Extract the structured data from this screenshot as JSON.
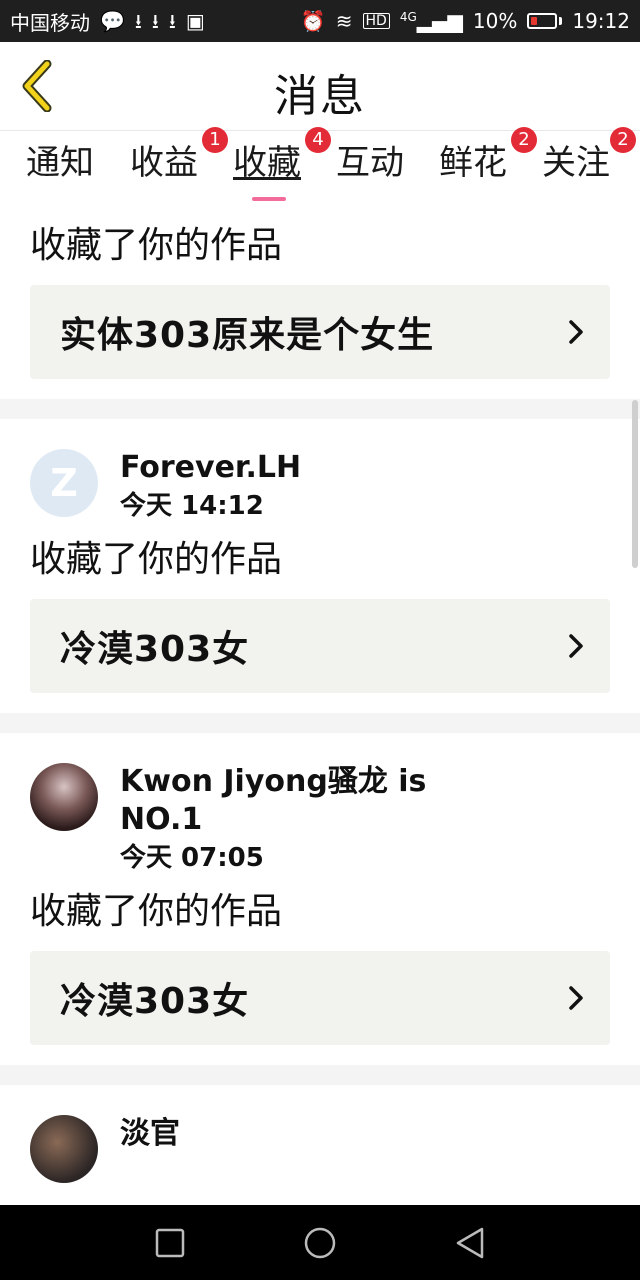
{
  "status_bar": {
    "carrier": "中国移动",
    "network": "4G",
    "battery": "10%",
    "time": "19:12",
    "icons": [
      "wechat-icon",
      "download-icon",
      "download-icon",
      "download-icon",
      "image-icon",
      "alarm-icon",
      "wifi-icon",
      "hd-icon",
      "signal-icon",
      "battery-icon"
    ]
  },
  "header": {
    "title": "消息",
    "back_icon": "chevron-left-icon"
  },
  "tabs": [
    {
      "label": "通知",
      "badge": ""
    },
    {
      "label": "收益",
      "badge": "1"
    },
    {
      "label": "收藏",
      "badge": "4",
      "active": true
    },
    {
      "label": "互动",
      "badge": ""
    },
    {
      "label": "鲜花",
      "badge": "2"
    },
    {
      "label": "关注",
      "badge": "2"
    }
  ],
  "items": [
    {
      "action": "收藏了你的作品",
      "work_title": "实体303原来是个女生"
    },
    {
      "user": "Forever.LH",
      "time": "今天 14:12",
      "action": "收藏了你的作品",
      "work_title": "冷漠303女"
    },
    {
      "user": "Kwon Jiyong骚龙 is NO.1",
      "time": "今天 07:05",
      "action": "收藏了你的作品",
      "work_title": "冷漠303女"
    },
    {
      "user": "淡官"
    }
  ],
  "nav_bar": {
    "icons": [
      "recent-apps-icon",
      "home-icon",
      "back-icon"
    ]
  },
  "colors": {
    "accent": "#f36b9a",
    "badge": "#e32b37",
    "back_icon": "#f2d21b",
    "card_bg": "#f2f2ee"
  }
}
